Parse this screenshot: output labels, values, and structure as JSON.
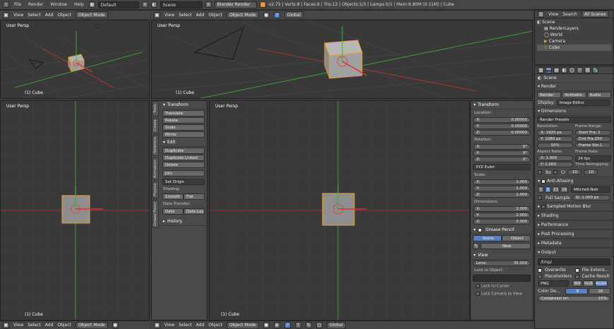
{
  "topbar": {
    "menus": [
      "File",
      "Render",
      "Window",
      "Help"
    ],
    "screen_layout": "Default",
    "scene_name": "Scene",
    "engine": "Blender Render",
    "stats": "v2.75 | Verts:8 | Faces:6 | Tris:12 | Objects:1/3 | Lamps:0/1 | Mem:6.80M (0.11M) | Cube"
  },
  "viewports": {
    "tl": {
      "label": "User Persp",
      "object": "(1) Cube"
    },
    "tr": {
      "label": "User Persp",
      "object": "(1) Cube"
    },
    "bl": {
      "label": "User Persp",
      "object": "(1) Cube"
    },
    "br": {
      "label": "User Persp",
      "object": "(1) Cube"
    }
  },
  "view3d_header": {
    "menus": [
      "View",
      "Select",
      "Add",
      "Object"
    ],
    "mode": "Object Mode",
    "orientation": "Global"
  },
  "toolshelf": {
    "tabs": [
      "Tools",
      "Create",
      "Relations",
      "Animation",
      "Physics",
      "Grease Pencil"
    ],
    "transform_title": "Transform",
    "transform": [
      "Translate",
      "Rotate",
      "Scale",
      "Mirror"
    ],
    "edit_title": "Edit",
    "edit": [
      "Duplicate",
      "Duplicate Linked",
      "Delete",
      "Join"
    ],
    "set_origin": "Set Origin",
    "shading_label": "Shading:",
    "smooth": "Smooth",
    "flat": "Flat",
    "data_transfer_label": "Data Transfer:",
    "data": "Data",
    "data_layo": "Data Layo",
    "history_title": "History"
  },
  "npanel": {
    "transform_title": "Transform",
    "location_label": "Location:",
    "location": [
      {
        "axis": "X:",
        "val": "0.00000"
      },
      {
        "axis": "Y:",
        "val": "0.00000"
      },
      {
        "axis": "Z:",
        "val": "0.00000"
      }
    ],
    "rotation_label": "Rotation:",
    "rotation": [
      {
        "axis": "X:",
        "val": "0°"
      },
      {
        "axis": "Y:",
        "val": "0°"
      },
      {
        "axis": "Z:",
        "val": "0°"
      }
    ],
    "rotation_mode": "XYZ Euler",
    "scale_label": "Scale:",
    "scale": [
      {
        "axis": "X:",
        "val": "1.000"
      },
      {
        "axis": "Y:",
        "val": "1.000"
      },
      {
        "axis": "Z:",
        "val": "1.000"
      }
    ],
    "dimensions_label": "Dimensions:",
    "dimensions": [
      {
        "axis": "X:",
        "val": "2.000"
      },
      {
        "axis": "Y:",
        "val": "2.000"
      },
      {
        "axis": "Z:",
        "val": "2.000"
      }
    ],
    "grease_pencil_title": "Grease Pencil",
    "gp_scene": "Scene",
    "gp_object": "Object",
    "gp_new": "New",
    "view_title": "View",
    "lens_label": "Lens:",
    "lens_val": "35.000",
    "lock_label": "Lock to Object:",
    "lock_cursor": "Lock to Cursor",
    "lock_camera": "Lock Camera to View"
  },
  "outliner": {
    "view": "View",
    "search": "Search",
    "filter": "All Scenes",
    "items": [
      "Scene",
      "RenderLayers",
      "World",
      "Camera",
      "Cube"
    ]
  },
  "properties": {
    "context": "Scene",
    "render_title": "Render",
    "render_btn": "Render",
    "animation_btn": "Animatio",
    "audio_btn": "Audio",
    "display_label": "Display:",
    "display_val": "Image Editor",
    "dimensions_title": "Dimensions",
    "presets": "Render Presets",
    "resolution_label": "Resolution:",
    "res_x": "X: 1920 px",
    "res_y": "Y: 1080 px",
    "res_pct": "50%",
    "frame_range_label": "Frame Range:",
    "start": "Start Fra: 1",
    "end": "End Fra:250",
    "step": "Frame Ste:1",
    "aspect_label": "Aspect Ratio:",
    "asp_x": "X: 1.000",
    "asp_y": "Y: 1.000",
    "frame_rate_label": "Frame Rate:",
    "fps": "24 fps",
    "time_remap_label": "Time Remapping:",
    "remap_old": "10",
    "remap_new": "10",
    "bo": "Bo",
    "cr": "Cr",
    "aa_title": "Anti-Aliasing",
    "aa_samples": [
      "5",
      "8",
      "11",
      "16"
    ],
    "aa_filter": "Mitchell-Netr",
    "full_sample": "Full Sample",
    "aa_size": "Si: 1.000 px",
    "smb_title": "Sampled Motion Blur",
    "shading_title": "Shading",
    "performance_title": "Performance",
    "post_title": "Post Processing",
    "metadata_title": "Metadata",
    "output_title": "Output",
    "output_path": "/tmp/",
    "overwrite": "Overwrite",
    "file_ext": "File Extens...",
    "placeholders": "Placeholders",
    "cache_result": "Cache Result",
    "format": "PNG",
    "bw": "BW",
    "rgb": "RGB",
    "rgba": "RGBA",
    "color_depth_label": "Color De...",
    "depth_8": "8",
    "depth_16": "16",
    "compression": "Compressi on:",
    "compression_val": "15%"
  },
  "colors": {
    "accent": "#5680c2",
    "selection": "#f0a030",
    "x_axis": "#c83232",
    "y_axis": "#3cb43c",
    "z_axis": "#3264c8"
  }
}
